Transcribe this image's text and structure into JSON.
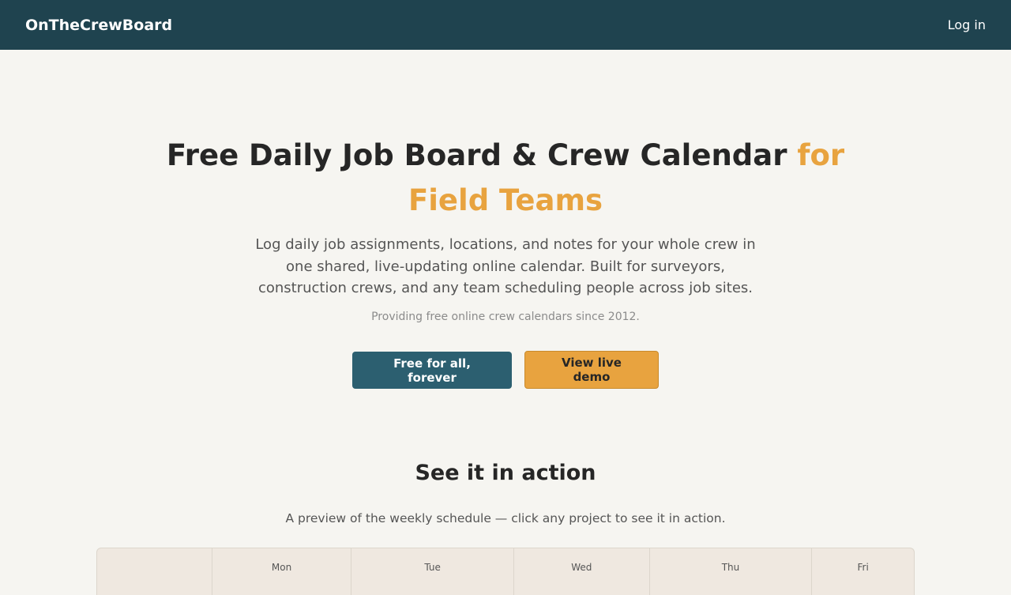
{
  "header": {
    "brand": "OnTheCrewBoard",
    "login_label": "Log in"
  },
  "hero": {
    "title_main": "Free Daily Job Board & Crew Calendar ",
    "title_accent": "for Field Teams",
    "subtitle": "Log daily job assignments, locations, and notes for your whole crew in one shared, live-updating online calendar. Built for surveyors, construction crews, and any team scheduling people across job sites.",
    "since": "Providing free online crew calendars since 2012."
  },
  "cta": {
    "primary_label": "Free for all, forever",
    "secondary_label": "View live demo"
  },
  "preview": {
    "title": "See it in action",
    "subtitle": "A preview of the weekly schedule — click any project to see it in action.",
    "days": [
      "",
      "Mon",
      "Tue",
      "Wed",
      "Thu",
      "Fri"
    ]
  },
  "colors": {
    "header_bg": "#1f434f",
    "accent": "#e8a33f",
    "primary_button": "#2c5f70",
    "page_bg": "#f6f5f1"
  }
}
